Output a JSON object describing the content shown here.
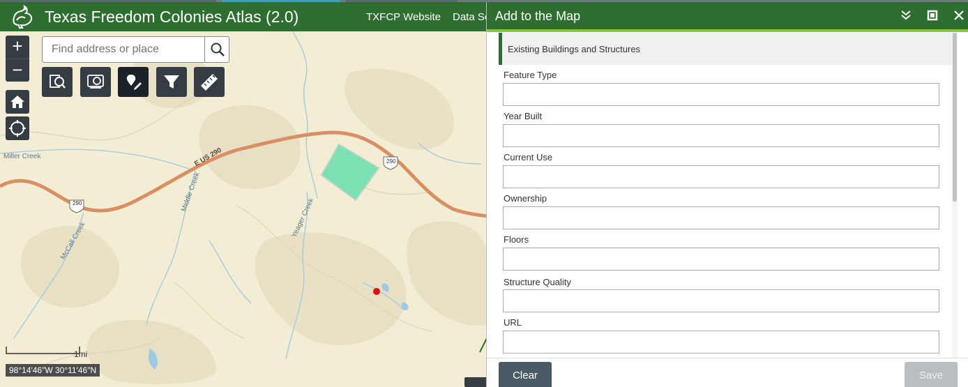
{
  "header": {
    "title": "Texas Freedom Colonies Atlas (2.0)",
    "links": [
      "TXFCP Website",
      "Data Sc"
    ],
    "color": "#2e6e30"
  },
  "map": {
    "search_placeholder": "Find address or place",
    "zoom_in": "+",
    "zoom_out": "−",
    "scale_label": "1mi",
    "coordinates": "98°14′46″W 30°11′46″N",
    "labels": {
      "miller_creek": "Miller Creek",
      "us290": "E US 290",
      "shield_290_a": "290",
      "shield_290_b": "290",
      "middle_creek": "Middle Creek",
      "yeager_creek": "Yeager Creek",
      "mccall_creek": "McCall Creek"
    },
    "tools": [
      "search-tool-icon",
      "layers-tool-icon",
      "edit-tool-icon",
      "filter-icon",
      "measure-icon"
    ]
  },
  "panel": {
    "title": "Add to the Map",
    "layer_name": "Existing Buildings and Structures",
    "fields": [
      {
        "label": "Feature Type",
        "value": ""
      },
      {
        "label": "Year Built",
        "value": ""
      },
      {
        "label": "Current Use",
        "value": ""
      },
      {
        "label": "Ownership",
        "value": ""
      },
      {
        "label": "Floors",
        "value": ""
      },
      {
        "label": "Structure Quality",
        "value": ""
      },
      {
        "label": "URL",
        "value": ""
      }
    ],
    "clear_label": "Clear",
    "save_label": "Save"
  }
}
